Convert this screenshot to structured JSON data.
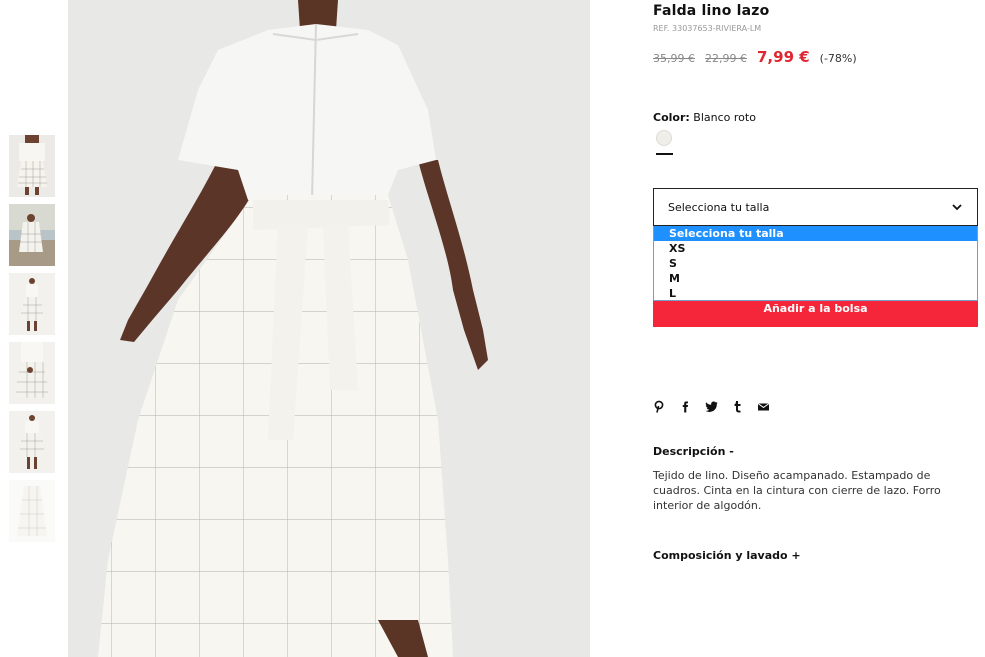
{
  "product": {
    "title": "Falda lino lazo",
    "ref": "REF. 33037653-RIVIERA-LM",
    "price_original": "35,99 €",
    "price_previous": "22,99 €",
    "price_current": "7,99 €",
    "discount": "(-78%)"
  },
  "color": {
    "label": "Color:",
    "value": "Blanco roto",
    "swatch_hex": "#efeee9"
  },
  "size_select": {
    "selected": "Selecciona tu talla",
    "options": [
      "Selecciona tu talla",
      "XS",
      "S",
      "M",
      "L"
    ],
    "highlight_hex": "#1e90ff"
  },
  "actions": {
    "add_to_bag": "Añadir a la bolsa",
    "add_to_bag_hex": "#f5253a"
  },
  "share_icons": [
    "pinterest-icon",
    "facebook-icon",
    "twitter-icon",
    "tumblr-icon",
    "mail-icon"
  ],
  "description": {
    "heading": "Descripción -",
    "text": "Tejido de lino. Diseño acampanado. Estampado de cuadros. Cinta en la cintura con cierre de lazo. Forro interior de algodón."
  },
  "composition": {
    "heading": "Composición y lavado +"
  },
  "gallery": {
    "thumbnail_count": 6,
    "price_accent_hex": "#e0262f"
  }
}
